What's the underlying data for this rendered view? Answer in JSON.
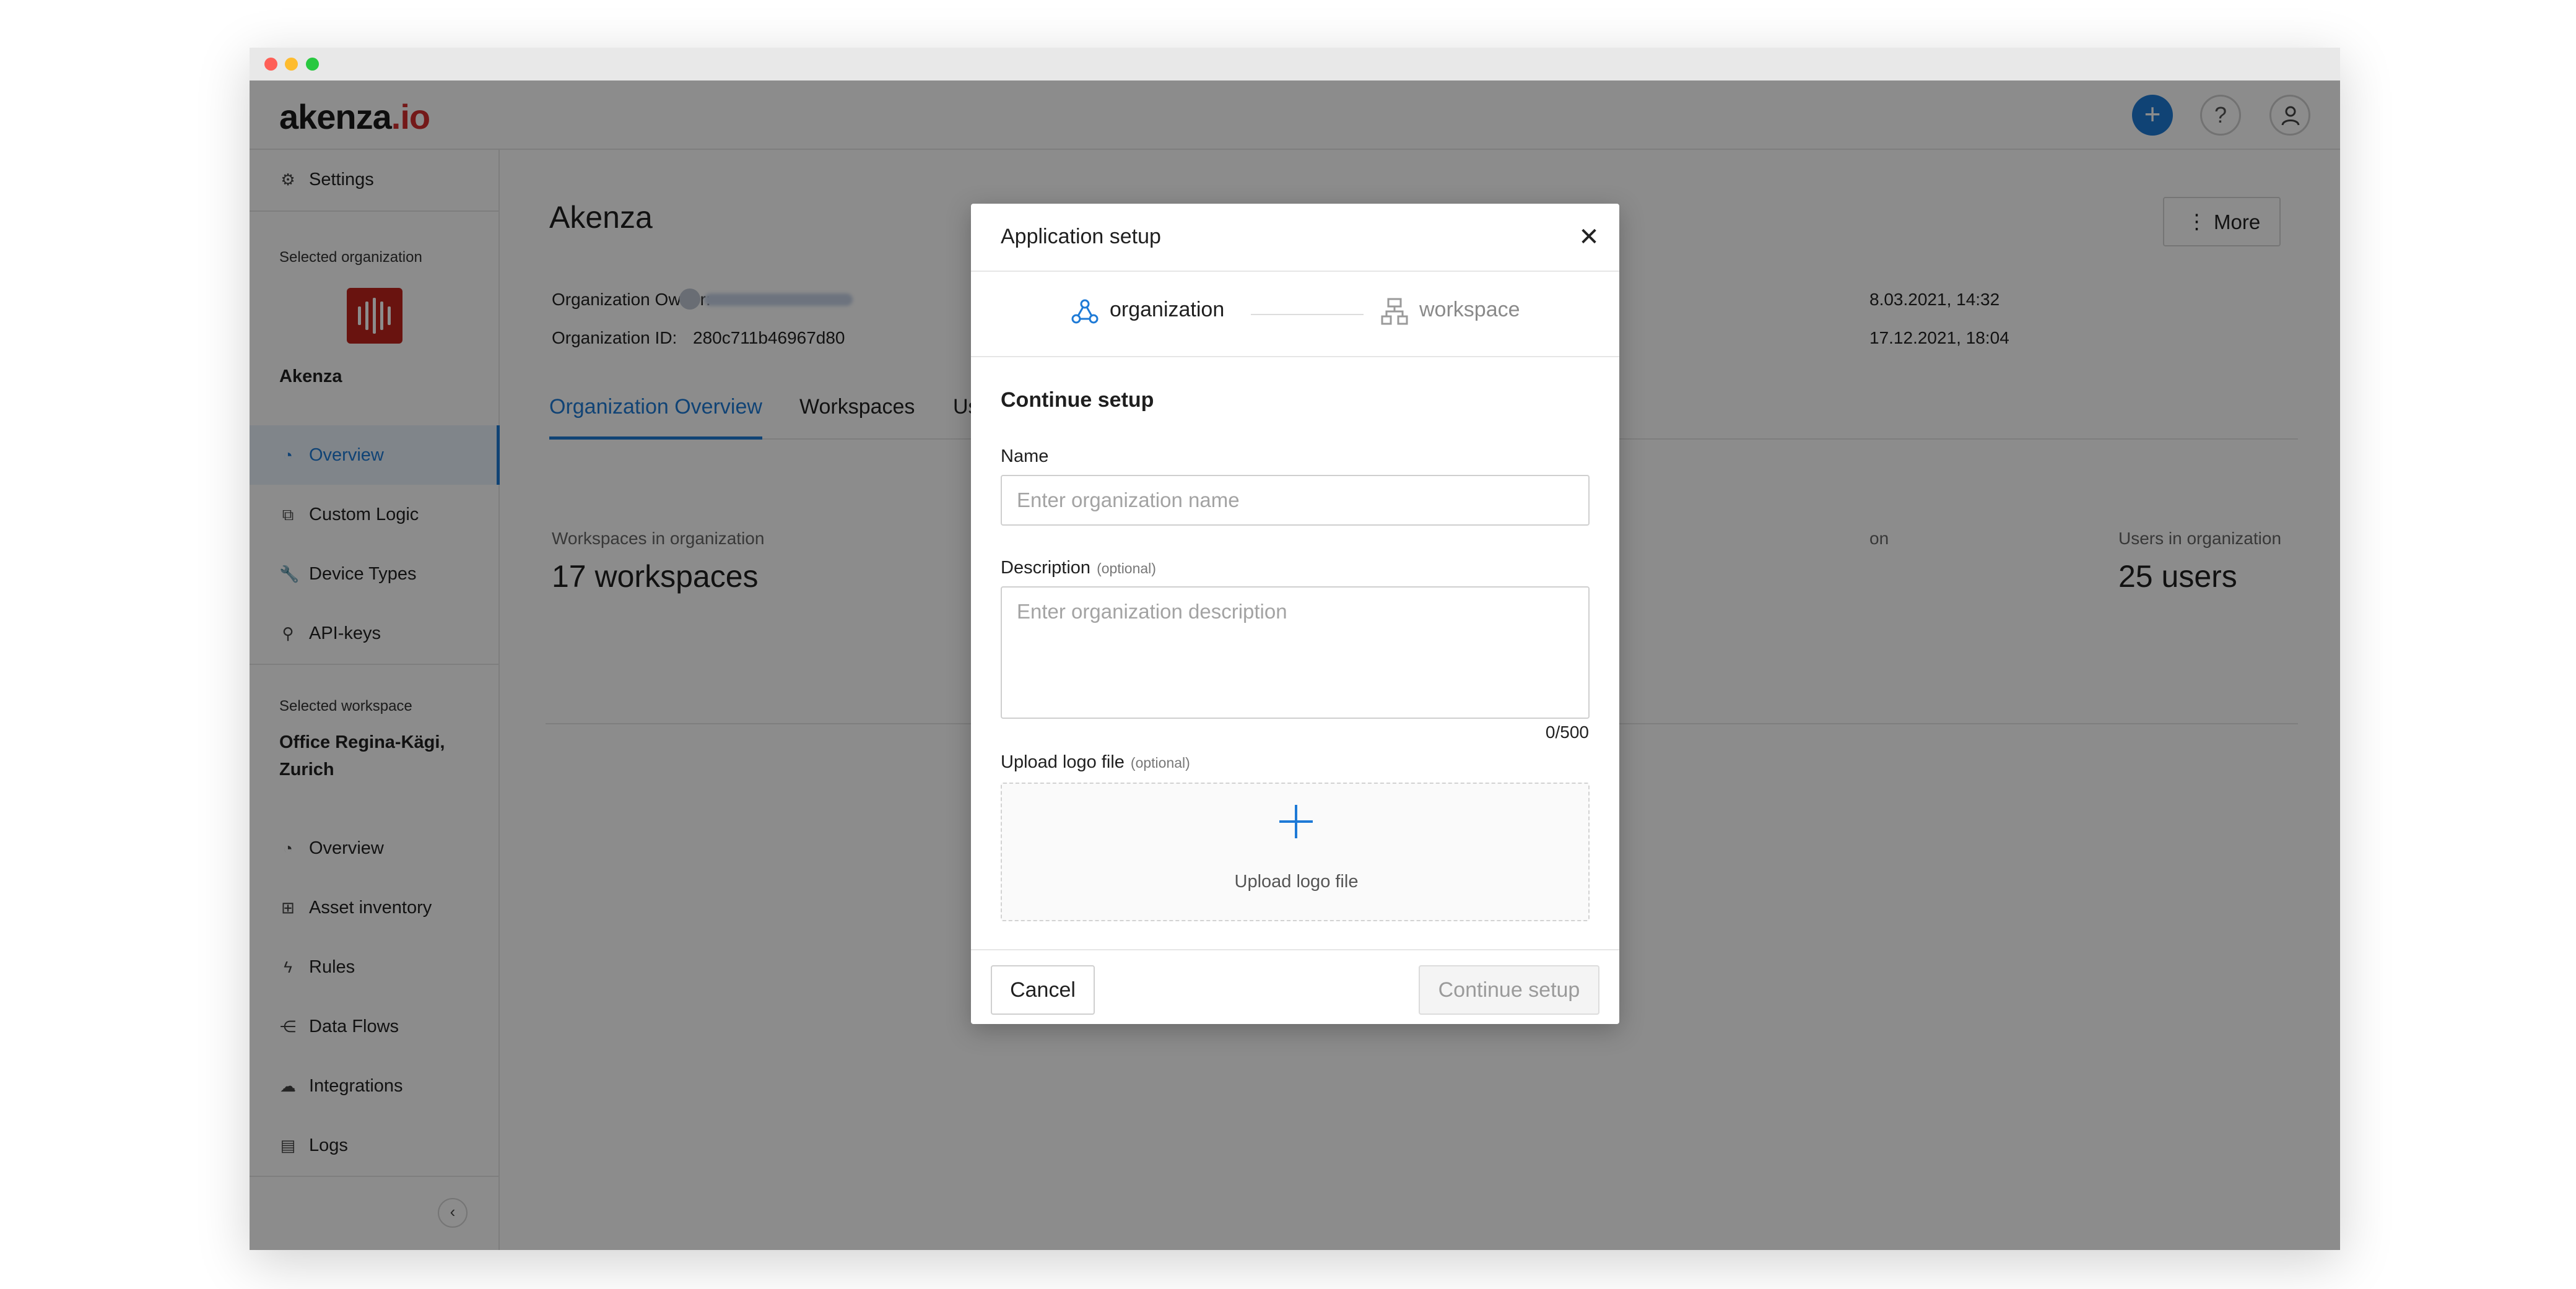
{
  "app": {
    "logo_main": "akenza",
    "logo_io": ".io",
    "add_glyph": "+",
    "help_glyph": "?"
  },
  "sidebar": {
    "settings_label": "Settings",
    "selected_org_label": "Selected organization",
    "org_name": "Akenza",
    "org_items": [
      {
        "label": "Overview",
        "icon": "dashboard-icon",
        "active": true
      },
      {
        "label": "Custom Logic",
        "icon": "copy-icon",
        "active": false
      },
      {
        "label": "Device Types",
        "icon": "wrench-icon",
        "active": false
      },
      {
        "label": "API-keys",
        "icon": "key-icon",
        "active": false
      }
    ],
    "selected_ws_label": "Selected workspace",
    "ws_name": "Office Regina-Kägi, Zurich",
    "ws_items": [
      {
        "label": "Overview",
        "icon": "dashboard-icon"
      },
      {
        "label": "Asset inventory",
        "icon": "assets-icon"
      },
      {
        "label": "Rules",
        "icon": "bolt-icon"
      },
      {
        "label": "Data Flows",
        "icon": "share-icon"
      },
      {
        "label": "Integrations",
        "icon": "cloud-icon"
      },
      {
        "label": "Logs",
        "icon": "logs-icon"
      }
    ],
    "collapse_glyph": "‹"
  },
  "main": {
    "title": "Akenza",
    "more_label": "More",
    "owner_label": "Organization Owner:",
    "id_label": "Organization ID:",
    "id_value": "280c711b46967d80",
    "created_partial": "8.03.2021, 14:32",
    "updated_partial": "17.12.2021, 18:04",
    "tabs": [
      "Organization Overview",
      "Workspaces",
      "Us"
    ],
    "stats": [
      {
        "label": "Workspaces in organization",
        "value": "17 workspaces"
      },
      {
        "label": "on",
        "value": ""
      },
      {
        "label": "Users in organization",
        "value": "25 users"
      }
    ]
  },
  "modal": {
    "title": "Application setup",
    "close_glyph": "✕",
    "steps": [
      {
        "label": "organization",
        "active": true
      },
      {
        "label": "workspace",
        "active": false
      }
    ],
    "section_title": "Continue setup",
    "name_label": "Name",
    "name_placeholder": "Enter organization name",
    "name_value": "",
    "description_label": "Description",
    "optional_label": "(optional)",
    "description_placeholder": "Enter organization description",
    "description_value": "",
    "counter": "0/500",
    "upload_label": "Upload logo file",
    "upload_text": "Upload logo file",
    "cancel_label": "Cancel",
    "continue_label": "Continue setup"
  },
  "colors": {
    "accent": "#1e7ad6",
    "brand_red": "#c0241c",
    "overlay": "rgba(0,0,0,0.45)"
  }
}
